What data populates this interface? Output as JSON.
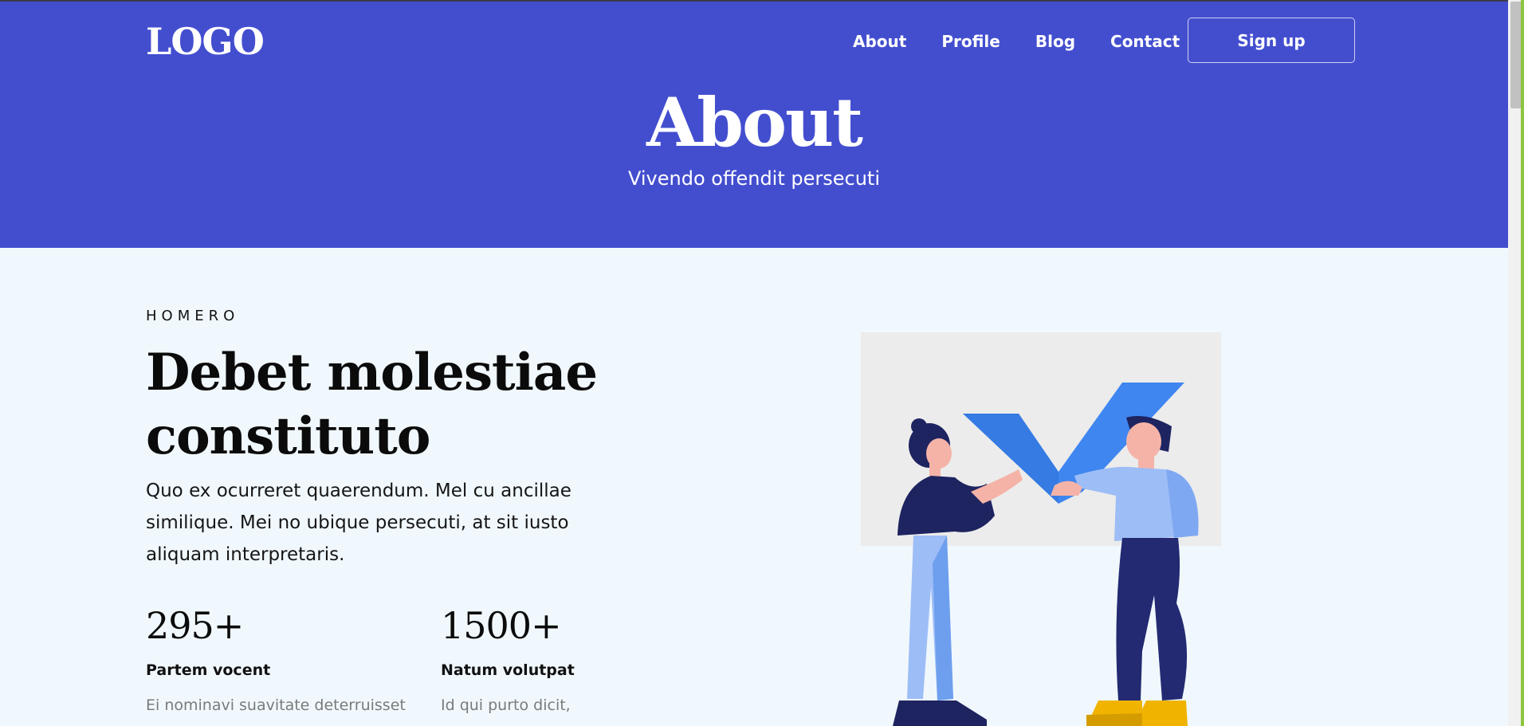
{
  "header": {
    "logo": "LOGO",
    "nav": [
      "About",
      "Profile",
      "Blog",
      "Contact"
    ],
    "signup": "Sign up",
    "title": "About",
    "subtitle": "Vivendo offendit persecuti"
  },
  "main": {
    "eyebrow": "HOMERO",
    "heading": "Debet molestiae constituto",
    "paragraph": "Quo ex ocurreret quaerendum. Mel cu ancillae similique. Mei no ubique persecuti, at sit iusto aliquam interpretaris.",
    "stats": [
      {
        "number": "295+",
        "label": "Partem vocent",
        "desc": "Ei nominavi suavitate deterruisset"
      },
      {
        "number": "1500+",
        "label": "Natum volutpat",
        "desc": "Id qui purto dicit,"
      }
    ]
  },
  "colors": {
    "brand": "#434ecf",
    "background": "#f0f8fe",
    "accent_blue": "#3f86f0",
    "accent_yellow": "#f0b400"
  },
  "icons": {
    "illustration": "two-people-holding-checkmark"
  }
}
